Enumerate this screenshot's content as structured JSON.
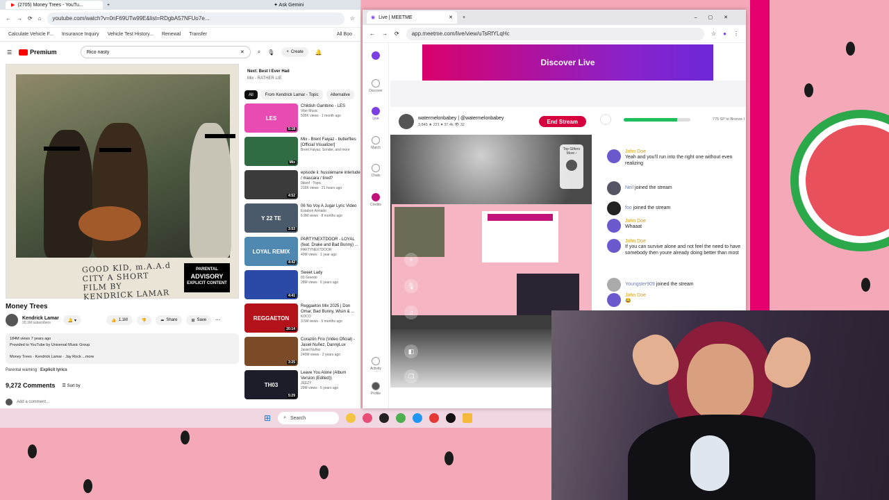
{
  "youtube": {
    "tab_title": "(2705) Money Trees - YouTu...",
    "ask_gemini": "Ask Gemini",
    "url": "youtube.com/watch?v=0nF69UTw99E&list=RDgbA57NFUo7e...",
    "bookmarks": [
      "Calculate Vehicle F...",
      "Insurance Inquiry",
      "Vehicle Test History...",
      "Renewal",
      "Transfer",
      "All Boo"
    ],
    "logo": "Premium",
    "search_value": "Rico nasty",
    "create_label": "Create",
    "notif_count": "9+",
    "album": {
      "text": "GOOD KID, m.A.A.d CITY A SHORT FILM BY KENDRICK LAMAR",
      "advisory_top": "PARENTAL",
      "advisory_mid": "ADVISORY",
      "advisory_bottom": "EXPLICIT CONTENT"
    },
    "video_title": "Money Trees",
    "channel": "Kendrick Lamar",
    "subscribers": "20.1M subscribers",
    "likes": "1.1M",
    "share": "Share",
    "save": "Save",
    "desc_views": "184M views  7 years ago",
    "desc_provided": "Provided to YouTube by Universal Music Group",
    "desc_tags": "Money Trees · Kendrick Lamar · Jay Rock ...more",
    "parental": "Parental warning",
    "explicit": "Explicit lyrics",
    "comments": "9,272 Comments",
    "sort_by": "Sort by",
    "add_comment": "Add a comment...",
    "next_label": "Next: Best I Ever Had",
    "next_sub": "Mix - RATHER LIE",
    "chips": [
      "All",
      "From Kendrick Lamar - Topic",
      "Alternative"
    ],
    "recs": [
      {
        "thumb": "LES",
        "title": "Childish Gambino - LES",
        "channel": "Vibe Music",
        "meta": "505K views · 1 month ago",
        "dur": "5:18",
        "color": "#e84bb1"
      },
      {
        "thumb": "",
        "title": "Mix - Brent Faiyaz - butterflies [Official Visualizer]",
        "channel": "Brent Faiyaz, Sonder, and more",
        "meta": "",
        "dur": "Mix",
        "color": "#2f6b43"
      },
      {
        "thumb": "",
        "title": "episode ii: husslemane interlude / mascara / tired?",
        "channel": "0kiesf · Topic",
        "meta": "216K views · 21 hours ago",
        "dur": "4:52",
        "color": "#3b3b3b"
      },
      {
        "thumb": "Y 22 TE",
        "title": "06 No Voy A Jugar Lyric Video",
        "channel": "Estabon Armado",
        "meta": "6.9M views · 8 months ago",
        "dur": "3:53",
        "color": "#4a5a6a"
      },
      {
        "thumb": "LOYAL REMIX",
        "title": "PARTYNEXTDOOR - LOYAL (feat. Drake and Bad Bunny) ...",
        "channel": "PARTYNEXTDOOR",
        "meta": "40M views · 1 year ago",
        "dur": "4:42",
        "color": "#4f88b0"
      },
      {
        "thumb": "",
        "title": "Sweet Lady",
        "channel": "03 Greedo",
        "meta": "28M views · 6 years ago",
        "dur": "4:41",
        "color": "#2b4aa8"
      },
      {
        "thumb": "REGGAETON",
        "title": "Reggaeton Mix 2025 | Don Omar, Bad Bunny, Wisin & ...",
        "channel": "KOCO",
        "meta": "3.5M views · 5 months ago",
        "dur": "20:14",
        "color": "#b3121a"
      },
      {
        "thumb": "",
        "title": "Corazón Frío (Video Oficial) - Jasiel Nuñez, DannyLux",
        "channel": "Jasiel Nuñez",
        "meta": "240M views · 2 years ago",
        "dur": "3:25",
        "color": "#7a4b26"
      },
      {
        "thumb": "TH03",
        "title": "Leave You Alone (Album Version (Edited))",
        "channel": "JEEZY",
        "meta": "29M views · 5 years ago",
        "dur": "5:29",
        "color": "#1d1d2a"
      }
    ]
  },
  "taskbar": {
    "search": "Search"
  },
  "meetme": {
    "tab_title": "Live | MEETME",
    "url": "app.meetme.com/live/view/uTsRfYLqHc",
    "rail": [
      "Discover",
      "Live",
      "Match",
      "Chats",
      "Credits",
      "Activity",
      "Profile"
    ],
    "banner": "Discover Live",
    "streamer": "watermelonbabey | @watermelonbabey",
    "stats": "3,845  ★ 221  ♥ 37.4k  👁 32",
    "end_stream": "End Stream",
    "top_gifters": "Top Gifters",
    "more": "More ›",
    "progress_text": "775 SP to Bronze I",
    "progress": 0.8,
    "messages": [
      {
        "name": "John Doe",
        "text": "Yeah and you'll run into the right one without even realizing",
        "joined": false,
        "color": "#6a5acd"
      },
      {
        "name": "Neil",
        "text": "joined the stream",
        "joined": true,
        "color": "#556"
      },
      {
        "name": "foo",
        "text": "joined the stream",
        "joined": true,
        "color": "#222"
      },
      {
        "name": "John Doe",
        "text": "Whaaat",
        "joined": false,
        "color": "#6a5acd"
      },
      {
        "name": "John Doe",
        "text": "If you can survive alone and not feel the need to have somebody then youre already doing better than most",
        "joined": false,
        "color": "#6a5acd"
      },
      {
        "name": "Youngster909",
        "text": "joined the stream",
        "joined": true,
        "color": "#aaa"
      },
      {
        "name": "John Doe",
        "text": "😂",
        "joined": false,
        "color": "#6a5acd"
      },
      {
        "name": "John Doe",
        "text": "",
        "joined": false,
        "color": "#6a5acd"
      }
    ]
  },
  "colors": {
    "accent": "#d6003f",
    "wall": "#f5a9b8",
    "progress": "#1fbe5c"
  }
}
